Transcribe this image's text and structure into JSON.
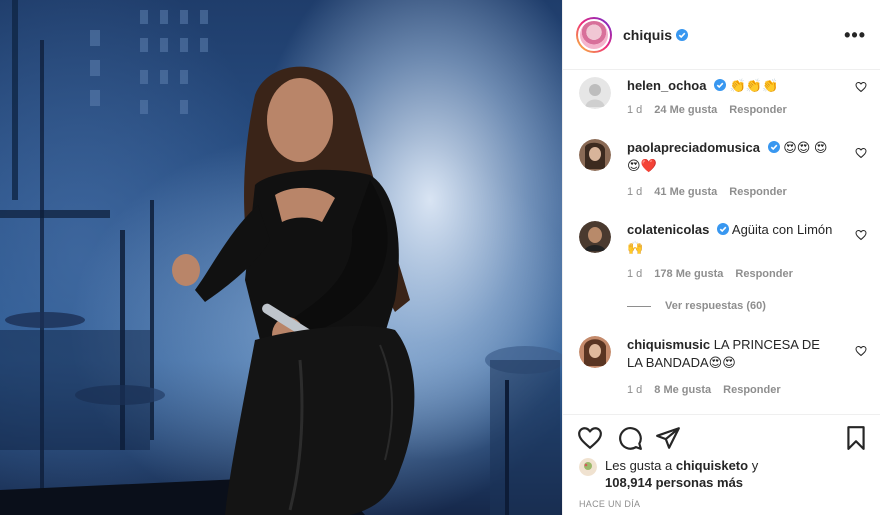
{
  "post": {
    "author": "chiquis",
    "verified": true,
    "more_icon": "more-horizontal-icon"
  },
  "comments": [
    {
      "user": "helen_ochoa",
      "verified": true,
      "text": "👏👏👏",
      "time": "1 d",
      "likes": "24 Me gusta",
      "reply": "Responder"
    },
    {
      "user": "paolapreciadomusica",
      "verified": true,
      "text": "😍😍 😍😍❤️",
      "time": "1 d",
      "likes": "41 Me gusta",
      "reply": "Responder"
    },
    {
      "user": "colatenicolas",
      "verified": true,
      "text": "Agüita con Limón 🙌",
      "time": "1 d",
      "likes": "178 Me gusta",
      "reply": "Responder"
    },
    {
      "user": "chiquismusic",
      "verified": false,
      "text": "LA PRINCESA DE LA BANDADA😍😍",
      "time": "1 d",
      "likes": "8 Me gusta",
      "reply": "Responder"
    }
  ],
  "view_replies": "Ver respuestas (60)",
  "actions": {
    "like_icon": "heart-icon",
    "comment_icon": "comment-icon",
    "share_icon": "send-icon",
    "save_icon": "bookmark-icon"
  },
  "likes_summary": {
    "prefix": "Les gusta a",
    "user": "chiquisketo",
    "connector": "y",
    "count": "108,914 personas más"
  },
  "time_ago": "HACE UN DÍA",
  "colors": {
    "verified": "#3897f0",
    "muted": "#8e8e8e",
    "text": "#262626",
    "border": "#efefef"
  }
}
